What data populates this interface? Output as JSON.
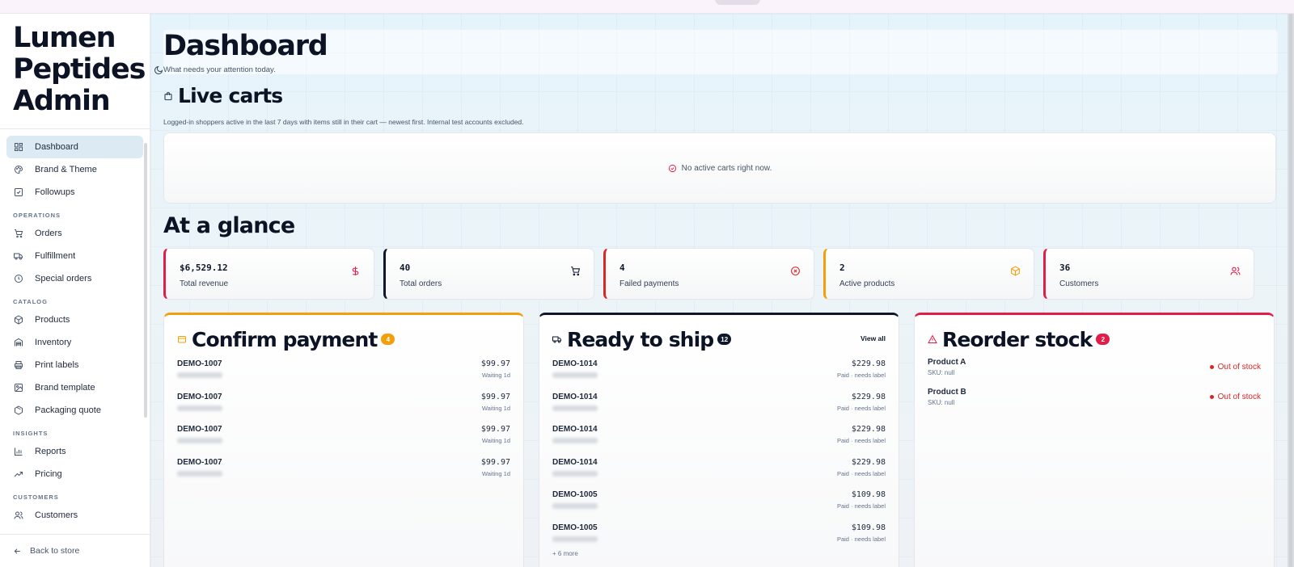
{
  "app": {
    "brand": "Lumen Peptides Admin"
  },
  "sidebar": {
    "items": [
      {
        "label": "Dashboard",
        "icon": "dashboard-icon",
        "active": true
      },
      {
        "label": "Brand & Theme",
        "icon": "palette-icon"
      },
      {
        "label": "Followups",
        "icon": "checkbox-icon"
      }
    ],
    "sections": [
      {
        "label": "OPERATIONS",
        "items": [
          {
            "label": "Orders",
            "icon": "cart-icon"
          },
          {
            "label": "Fulfillment",
            "icon": "truck-icon"
          },
          {
            "label": "Special orders",
            "icon": "clock-icon"
          }
        ]
      },
      {
        "label": "CATALOG",
        "items": [
          {
            "label": "Products",
            "icon": "package-icon"
          },
          {
            "label": "Inventory",
            "icon": "warehouse-icon"
          },
          {
            "label": "Print labels",
            "icon": "printer-icon"
          },
          {
            "label": "Brand template",
            "icon": "image-icon"
          },
          {
            "label": "Packaging quote",
            "icon": "box-icon"
          }
        ]
      },
      {
        "label": "INSIGHTS",
        "items": [
          {
            "label": "Reports",
            "icon": "bar-chart-icon"
          },
          {
            "label": "Pricing",
            "icon": "trending-up-icon"
          }
        ]
      },
      {
        "label": "CUSTOMERS",
        "items": [
          {
            "label": "Customers",
            "icon": "users-icon"
          }
        ]
      }
    ],
    "back_label": "Back to store"
  },
  "header": {
    "title": "Dashboard",
    "subtitle": "What needs your attention today."
  },
  "live_carts": {
    "title": "Live carts",
    "subtitle": "Logged-in shoppers active in the last 7 days with items still in their cart — newest first. Internal test accounts excluded.",
    "empty": "No active carts right now."
  },
  "glance": {
    "title": "At a glance",
    "stats": [
      {
        "value": "$6,529.12",
        "label": "Total revenue",
        "icon": "dollar-icon",
        "color": "#e11d48"
      },
      {
        "value": "40",
        "label": "Total orders",
        "icon": "cart-icon",
        "color": "#0f172a"
      },
      {
        "value": "4",
        "label": "Failed payments",
        "icon": "x-circle-icon",
        "color": "#dc2626"
      },
      {
        "value": "2",
        "label": "Active products",
        "icon": "package-icon",
        "color": "#f59e0b"
      },
      {
        "value": "36",
        "label": "Customers",
        "icon": "users-icon",
        "color": "#e11d48"
      }
    ]
  },
  "confirm_payment": {
    "title": "Confirm payment",
    "count": "4",
    "color": "#f59e0b",
    "rows": [
      {
        "id": "DEMO-1007",
        "amount": "$99.97",
        "meta": "Waiting 1d"
      },
      {
        "id": "DEMO-1007",
        "amount": "$99.97",
        "meta": "Waiting 1d"
      },
      {
        "id": "DEMO-1007",
        "amount": "$99.97",
        "meta": "Waiting 1d"
      },
      {
        "id": "DEMO-1007",
        "amount": "$99.97",
        "meta": "Waiting 1d"
      }
    ]
  },
  "ready_to_ship": {
    "title": "Ready to ship",
    "count": "12",
    "color": "#0f172a",
    "view_all": "View all",
    "rows": [
      {
        "id": "DEMO-1014",
        "amount": "$229.98",
        "meta": "Paid · needs label"
      },
      {
        "id": "DEMO-1014",
        "amount": "$229.98",
        "meta": "Paid · needs label"
      },
      {
        "id": "DEMO-1014",
        "amount": "$229.98",
        "meta": "Paid · needs label"
      },
      {
        "id": "DEMO-1014",
        "amount": "$229.98",
        "meta": "Paid · needs label"
      },
      {
        "id": "DEMO-1005",
        "amount": "$109.98",
        "meta": "Paid · needs label"
      },
      {
        "id": "DEMO-1005",
        "amount": "$109.98",
        "meta": "Paid · needs label"
      }
    ],
    "more": "+ 6 more"
  },
  "reorder_stock": {
    "title": "Reorder stock",
    "count": "2",
    "color": "#e11d48",
    "rows": [
      {
        "name": "Product A",
        "sku": "SKU: null",
        "status": "Out of stock"
      },
      {
        "name": "Product B",
        "sku": "SKU: null",
        "status": "Out of stock"
      }
    ]
  }
}
